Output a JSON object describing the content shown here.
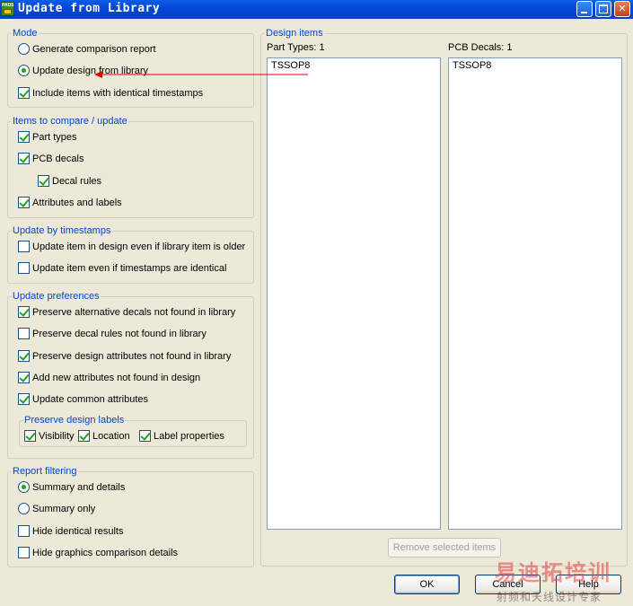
{
  "window": {
    "title": "Update from Library",
    "app_icon_text": "PADS",
    "minimize_icon": "minimize-icon",
    "maximize_icon": "maximize-icon",
    "close_icon": "close-icon"
  },
  "mode": {
    "legend": "Mode",
    "generate_report": {
      "label": "Generate comparison report",
      "selected": false
    },
    "update_design": {
      "label": "Update design from library",
      "selected": true
    },
    "include_identical": {
      "label": "Include items with identical timestamps",
      "checked": true
    }
  },
  "compare": {
    "legend": "Items to compare / update",
    "part_types": {
      "label": "Part types",
      "checked": true
    },
    "pcb_decals": {
      "label": "PCB decals",
      "checked": true
    },
    "decal_rules": {
      "label": "Decal rules",
      "checked": true
    },
    "attributes_labels": {
      "label": "Attributes and labels",
      "checked": true
    }
  },
  "timestamps": {
    "legend": "Update by timestamps",
    "older": {
      "label": "Update item in design even if library item is older",
      "checked": false
    },
    "identical": {
      "label": "Update item even if timestamps are identical",
      "checked": false
    }
  },
  "preferences": {
    "legend": "Update preferences",
    "alt_decals": {
      "label": "Preserve alternative decals not found in library",
      "checked": true
    },
    "decal_rules": {
      "label": "Preserve decal rules not found in library",
      "checked": false
    },
    "design_attrs": {
      "label": "Preserve design attributes not found in library",
      "checked": true
    },
    "add_new_attrs": {
      "label": "Add new attributes not found in design",
      "checked": true
    },
    "common_attrs": {
      "label": "Update common attributes",
      "checked": true
    },
    "labels": {
      "legend": "Preserve design labels",
      "visibility": {
        "label": "Visibility",
        "checked": true
      },
      "location": {
        "label": "Location",
        "checked": true
      },
      "label_props": {
        "label": "Label properties",
        "checked": true
      }
    }
  },
  "report": {
    "legend": "Report filtering",
    "summary_details": {
      "label": "Summary and details",
      "selected": true
    },
    "summary_only": {
      "label": "Summary only",
      "selected": false
    },
    "hide_identical": {
      "label": "Hide identical results",
      "checked": false
    },
    "hide_graphics": {
      "label": "Hide graphics comparison details",
      "checked": false
    }
  },
  "design_items": {
    "legend": "Design items",
    "part_types_header": "Part Types: 1",
    "pcb_decals_header": "PCB Decals: 1",
    "part_types": [
      "TSSOP8"
    ],
    "pcb_decals": [
      "TSSOP8"
    ],
    "remove_button": "Remove selected items"
  },
  "buttons": {
    "ok": "OK",
    "cancel": "Cancel",
    "help": "Help"
  },
  "watermark": {
    "line1": "易迪拓培训",
    "line2": "射频和天线设计专家"
  },
  "colors": {
    "titlebar": "#0347d6",
    "legend_text": "#0046d5",
    "check_mark": "#21a121",
    "arrow": "#e00000",
    "dialog_bg": "#ece9d8"
  }
}
